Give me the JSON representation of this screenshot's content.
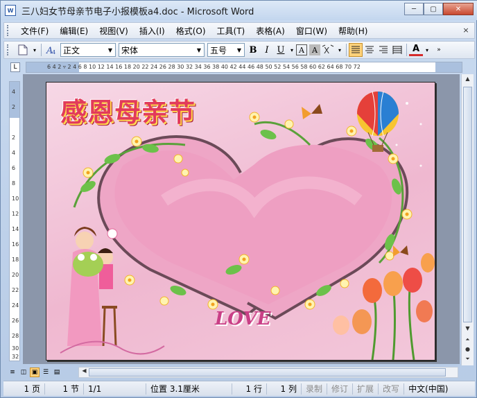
{
  "window": {
    "title": "三八妇女节母亲节电子小报模板a4.doc - Microsoft Word",
    "minimize_glyph": "─",
    "maximize_glyph": "▢",
    "close_glyph": "✕"
  },
  "menu": {
    "items": [
      "文件(F)",
      "编辑(E)",
      "视图(V)",
      "插入(I)",
      "格式(O)",
      "工具(T)",
      "表格(A)",
      "窗口(W)",
      "帮助(H)"
    ],
    "close_glyph": "×"
  },
  "toolbar": {
    "style_value": "正文",
    "font_value": "宋体",
    "size_value": "五号",
    "bold": "B",
    "italic": "I",
    "underline": "U",
    "char_border": "A",
    "char_shading": "A",
    "font_color": "A",
    "accent_color": "#d52b2b"
  },
  "ruler": {
    "ticks": "6  4  2  ▿  2  4  6  8  10 12 14 16 18 20 22 24 26 28 30 32 34 36 38 40 42 44 46 48 50 52 54 56 58 60 62 64   68 70 72",
    "v_ticks": [
      "4",
      "2",
      "2",
      "4",
      "6",
      "8",
      "10",
      "12",
      "14",
      "16",
      "18",
      "20",
      "22",
      "24",
      "26",
      "28",
      "30",
      "32"
    ],
    "tab_selector": "L"
  },
  "document": {
    "headline": "感恩母亲节",
    "love_text": "LOVE"
  },
  "status": {
    "page": "1 页",
    "section": "1 节",
    "page_of": "1/1",
    "position": "位置 3.1厘米",
    "line": "1 行",
    "column": "1 列",
    "rec": "录制",
    "track": "修订",
    "ext": "扩展",
    "ovr": "改写",
    "language": "中文(中国)"
  }
}
